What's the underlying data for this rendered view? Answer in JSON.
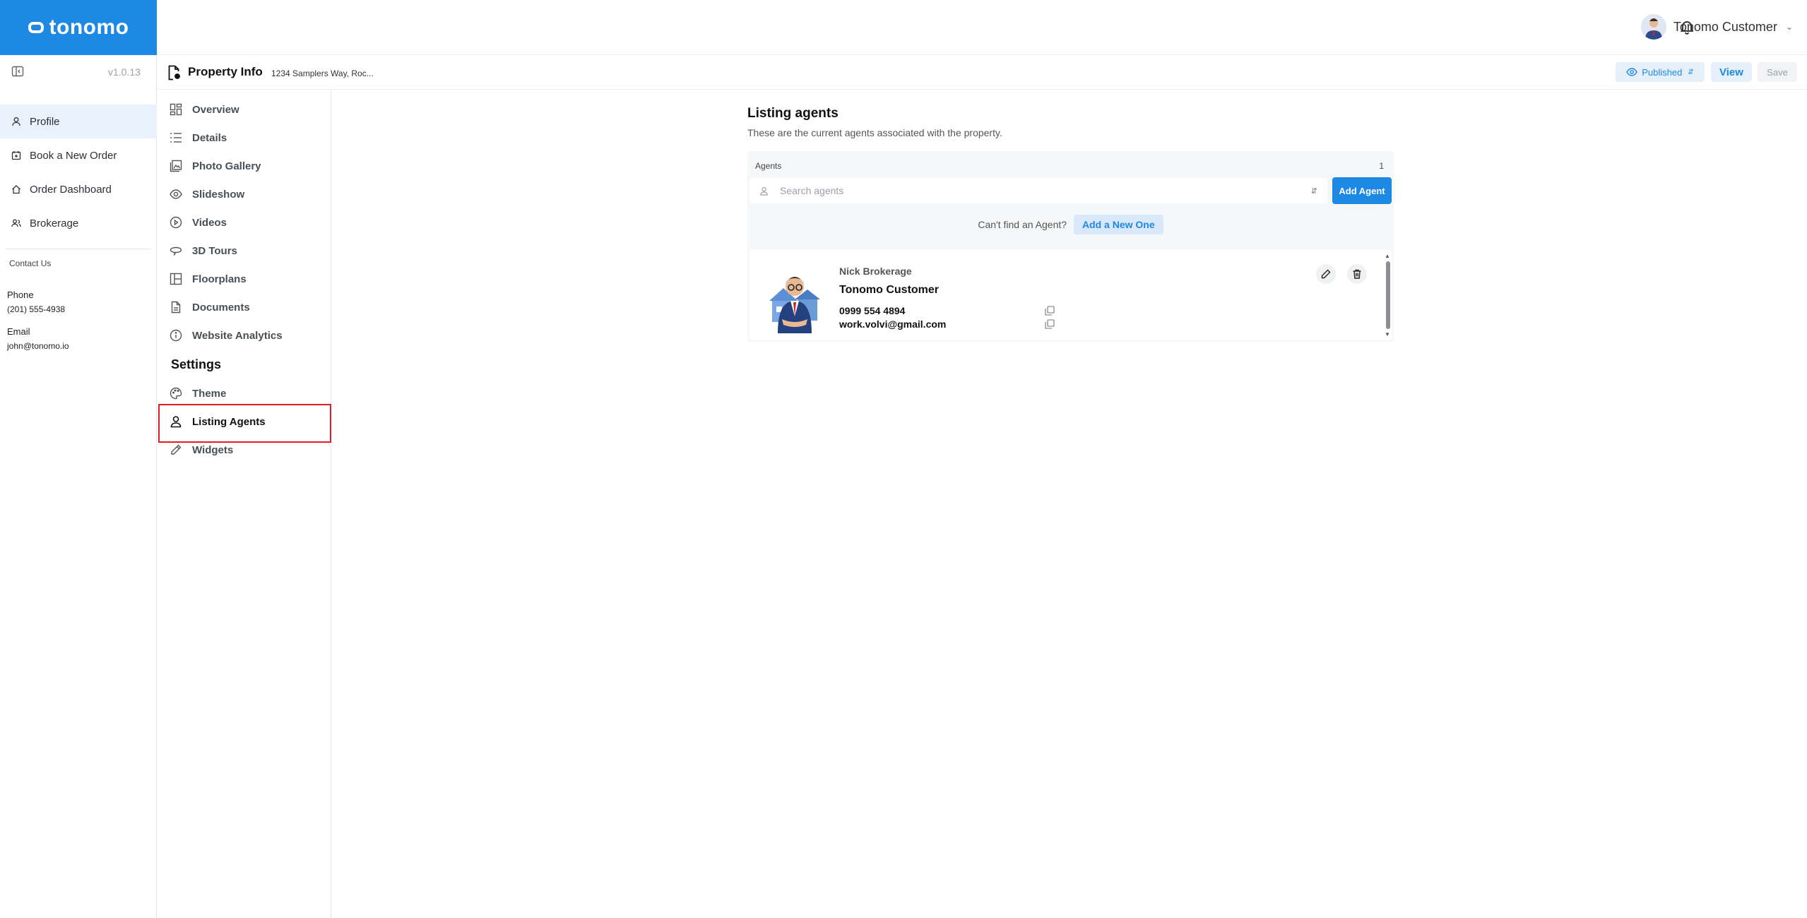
{
  "app": {
    "brand": "tonomo",
    "version": "v1.0.13"
  },
  "topbar": {
    "user_name": "Tonomo Customer"
  },
  "sidebar": {
    "items": [
      {
        "label": "Profile",
        "icon": "user-icon"
      },
      {
        "label": "Book a New Order",
        "icon": "calendar-plus-icon"
      },
      {
        "label": "Order Dashboard",
        "icon": "home-icon"
      },
      {
        "label": "Brokerage",
        "icon": "users-icon"
      }
    ],
    "contact_heading": "Contact Us",
    "phone_label": "Phone",
    "phone": "(201) 555-4938",
    "email_label": "Email",
    "email": "john@tonomo.io"
  },
  "subheader": {
    "title": "Property Info",
    "address": "1234 Samplers Way, Roc...",
    "status": "Published",
    "view_label": "View",
    "save_label": "Save"
  },
  "subnav": {
    "items": [
      {
        "label": "Overview",
        "icon": "grid-icon"
      },
      {
        "label": "Details",
        "icon": "list-icon"
      },
      {
        "label": "Photo Gallery",
        "icon": "gallery-icon"
      },
      {
        "label": "Slideshow",
        "icon": "eye-icon"
      },
      {
        "label": "Videos",
        "icon": "play-icon"
      },
      {
        "label": "3D Tours",
        "icon": "tour-icon"
      },
      {
        "label": "Floorplans",
        "icon": "floorplan-icon"
      },
      {
        "label": "Documents",
        "icon": "document-icon"
      },
      {
        "label": "Website Analytics",
        "icon": "info-icon"
      }
    ],
    "settings_heading": "Settings",
    "settings_items": [
      {
        "label": "Theme",
        "icon": "palette-icon"
      },
      {
        "label": "Listing Agents",
        "icon": "user-icon"
      },
      {
        "label": "Widgets",
        "icon": "pencil-icon"
      }
    ]
  },
  "main": {
    "title": "Listing agents",
    "description": "These are the current agents associated with the property.",
    "agents_label": "Agents",
    "agents_count": "1",
    "search_placeholder": "Search agents",
    "add_agent_label": "Add Agent",
    "cant_find_text": "Can't find an Agent?",
    "add_new_label": "Add a New One",
    "agent": {
      "brokerage": "Nick Brokerage",
      "name": "Tonomo Customer",
      "phone": "0999 554 4894",
      "email": "work.volvi@gmail.com"
    }
  },
  "colors": {
    "accent": "#1e88e5",
    "highlight": "#e11d22",
    "active_bg": "#e9f2fc"
  }
}
